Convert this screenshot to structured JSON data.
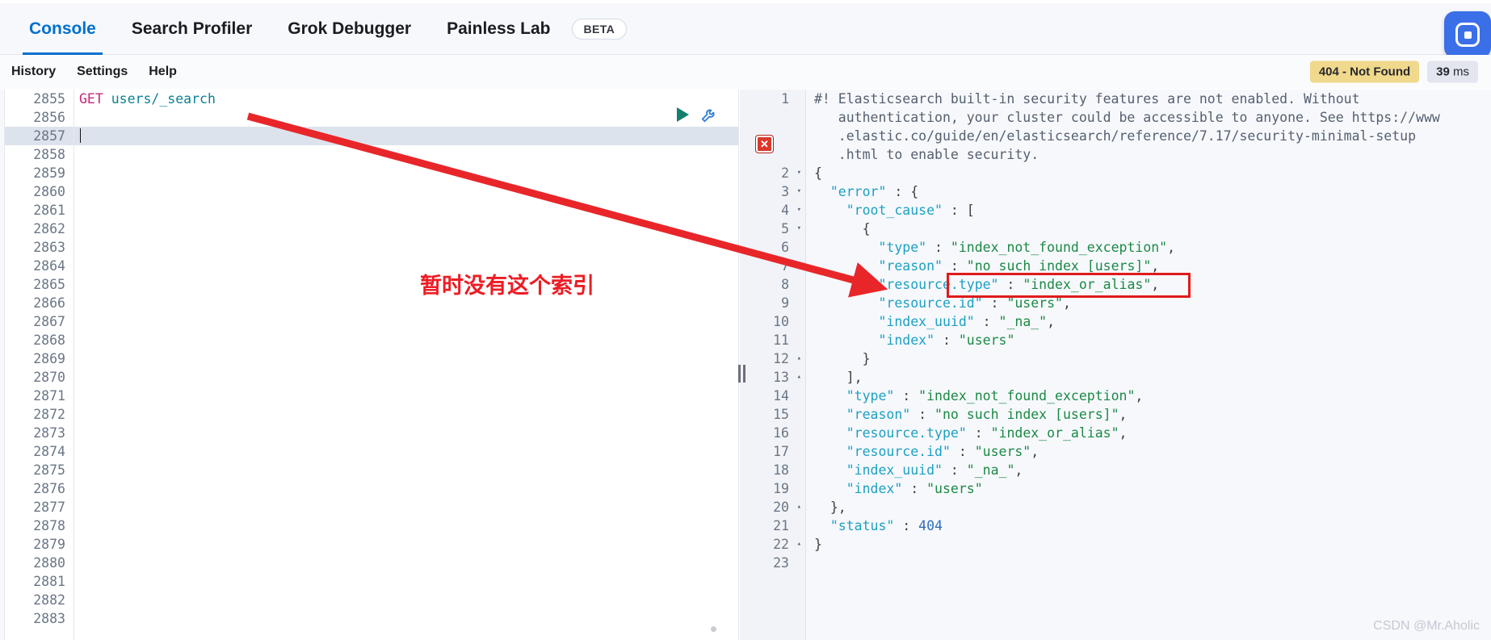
{
  "nav": {
    "tabs": [
      {
        "label": "Console",
        "active": true
      },
      {
        "label": "Search Profiler",
        "active": false
      },
      {
        "label": "Grok Debugger",
        "active": false
      },
      {
        "label": "Painless Lab",
        "active": false
      }
    ],
    "beta_badge": "BETA",
    "corner_icon": "app-logo-icon"
  },
  "subbar": {
    "links": [
      "History",
      "Settings",
      "Help"
    ],
    "status": "404 - Not Found",
    "time_value": "39",
    "time_unit": "ms",
    "status_color": "#f0d98c",
    "time_color": "#e3e6ef"
  },
  "request": {
    "first_line_number": 2855,
    "last_line_number": 2883,
    "highlighted_line": 2857,
    "method": "GET",
    "path": "users/_search",
    "run_icon": "play-icon",
    "tools_icon": "wrench-icon"
  },
  "response": {
    "error_marker_icon": "error-x-icon",
    "lines": [
      {
        "n": 1,
        "fold": "",
        "tokens": [
          {
            "t": "comment",
            "v": "#! Elasticsearch built-in security features are not enabled. Without"
          }
        ]
      },
      {
        "n": "",
        "fold": "",
        "tokens": [
          {
            "t": "comment",
            "v": "   authentication, your cluster could be accessible to anyone. See https://www"
          }
        ]
      },
      {
        "n": "",
        "fold": "",
        "tokens": [
          {
            "t": "comment",
            "v": "   .elastic.co/guide/en/elasticsearch/reference/7.17/security-minimal-setup"
          }
        ]
      },
      {
        "n": "",
        "fold": "",
        "tokens": [
          {
            "t": "comment",
            "v": "   .html to enable security."
          }
        ]
      },
      {
        "n": 2,
        "fold": "▾",
        "tokens": [
          {
            "t": "punct",
            "v": "{"
          }
        ]
      },
      {
        "n": 3,
        "fold": "▾",
        "tokens": [
          {
            "t": "punct",
            "v": "  "
          },
          {
            "t": "key",
            "v": "\"error\""
          },
          {
            "t": "punct",
            "v": " : {"
          }
        ]
      },
      {
        "n": 4,
        "fold": "▾",
        "tokens": [
          {
            "t": "punct",
            "v": "    "
          },
          {
            "t": "key",
            "v": "\"root_cause\""
          },
          {
            "t": "punct",
            "v": " : ["
          }
        ]
      },
      {
        "n": 5,
        "fold": "▾",
        "tokens": [
          {
            "t": "punct",
            "v": "      {"
          }
        ]
      },
      {
        "n": 6,
        "fold": "",
        "tokens": [
          {
            "t": "punct",
            "v": "        "
          },
          {
            "t": "key",
            "v": "\"type\""
          },
          {
            "t": "punct",
            "v": " : "
          },
          {
            "t": "str",
            "v": "\"index_not_found_exception\""
          },
          {
            "t": "punct",
            "v": ","
          }
        ]
      },
      {
        "n": 7,
        "fold": "",
        "tokens": [
          {
            "t": "punct",
            "v": "        "
          },
          {
            "t": "key",
            "v": "\"reason\""
          },
          {
            "t": "punct",
            "v": " : "
          },
          {
            "t": "str",
            "v": "\"no such index [users]\""
          },
          {
            "t": "punct",
            "v": ","
          }
        ]
      },
      {
        "n": 8,
        "fold": "",
        "tokens": [
          {
            "t": "punct",
            "v": "        "
          },
          {
            "t": "key",
            "v": "\"resource.type\""
          },
          {
            "t": "punct",
            "v": " : "
          },
          {
            "t": "str",
            "v": "\"index_or_alias\""
          },
          {
            "t": "punct",
            "v": ","
          }
        ]
      },
      {
        "n": 9,
        "fold": "",
        "tokens": [
          {
            "t": "punct",
            "v": "        "
          },
          {
            "t": "key",
            "v": "\"resource.id\""
          },
          {
            "t": "punct",
            "v": " : "
          },
          {
            "t": "str",
            "v": "\"users\""
          },
          {
            "t": "punct",
            "v": ","
          }
        ]
      },
      {
        "n": 10,
        "fold": "",
        "tokens": [
          {
            "t": "punct",
            "v": "        "
          },
          {
            "t": "key",
            "v": "\"index_uuid\""
          },
          {
            "t": "punct",
            "v": " : "
          },
          {
            "t": "str",
            "v": "\"_na_\""
          },
          {
            "t": "punct",
            "v": ","
          }
        ]
      },
      {
        "n": 11,
        "fold": "",
        "tokens": [
          {
            "t": "punct",
            "v": "        "
          },
          {
            "t": "key",
            "v": "\"index\""
          },
          {
            "t": "punct",
            "v": " : "
          },
          {
            "t": "str",
            "v": "\"users\""
          }
        ]
      },
      {
        "n": 12,
        "fold": "▴",
        "tokens": [
          {
            "t": "punct",
            "v": "      }"
          }
        ]
      },
      {
        "n": 13,
        "fold": "▴",
        "tokens": [
          {
            "t": "punct",
            "v": "    ],"
          }
        ]
      },
      {
        "n": 14,
        "fold": "",
        "tokens": [
          {
            "t": "punct",
            "v": "    "
          },
          {
            "t": "key",
            "v": "\"type\""
          },
          {
            "t": "punct",
            "v": " : "
          },
          {
            "t": "str",
            "v": "\"index_not_found_exception\""
          },
          {
            "t": "punct",
            "v": ","
          }
        ]
      },
      {
        "n": 15,
        "fold": "",
        "tokens": [
          {
            "t": "punct",
            "v": "    "
          },
          {
            "t": "key",
            "v": "\"reason\""
          },
          {
            "t": "punct",
            "v": " : "
          },
          {
            "t": "str",
            "v": "\"no such index [users]\""
          },
          {
            "t": "punct",
            "v": ","
          }
        ]
      },
      {
        "n": 16,
        "fold": "",
        "tokens": [
          {
            "t": "punct",
            "v": "    "
          },
          {
            "t": "key",
            "v": "\"resource.type\""
          },
          {
            "t": "punct",
            "v": " : "
          },
          {
            "t": "str",
            "v": "\"index_or_alias\""
          },
          {
            "t": "punct",
            "v": ","
          }
        ]
      },
      {
        "n": 17,
        "fold": "",
        "tokens": [
          {
            "t": "punct",
            "v": "    "
          },
          {
            "t": "key",
            "v": "\"resource.id\""
          },
          {
            "t": "punct",
            "v": " : "
          },
          {
            "t": "str",
            "v": "\"users\""
          },
          {
            "t": "punct",
            "v": ","
          }
        ]
      },
      {
        "n": 18,
        "fold": "",
        "tokens": [
          {
            "t": "punct",
            "v": "    "
          },
          {
            "t": "key",
            "v": "\"index_uuid\""
          },
          {
            "t": "punct",
            "v": " : "
          },
          {
            "t": "str",
            "v": "\"_na_\""
          },
          {
            "t": "punct",
            "v": ","
          }
        ]
      },
      {
        "n": 19,
        "fold": "",
        "tokens": [
          {
            "t": "punct",
            "v": "    "
          },
          {
            "t": "key",
            "v": "\"index\""
          },
          {
            "t": "punct",
            "v": " : "
          },
          {
            "t": "str",
            "v": "\"users\""
          }
        ]
      },
      {
        "n": 20,
        "fold": "▴",
        "tokens": [
          {
            "t": "punct",
            "v": "  },"
          }
        ]
      },
      {
        "n": 21,
        "fold": "",
        "tokens": [
          {
            "t": "punct",
            "v": "  "
          },
          {
            "t": "key",
            "v": "\"status\""
          },
          {
            "t": "punct",
            "v": " : "
          },
          {
            "t": "num",
            "v": "404"
          }
        ]
      },
      {
        "n": 22,
        "fold": "▴",
        "tokens": [
          {
            "t": "punct",
            "v": "}"
          }
        ]
      },
      {
        "n": 23,
        "fold": "",
        "tokens": [
          {
            "t": "punct",
            "v": ""
          }
        ]
      }
    ]
  },
  "annotations": {
    "note_text": "暂时没有这个索引",
    "note_color": "#ed1c24",
    "arrow_color": "#e8262a",
    "highlight_box_color": "#e01b1b"
  },
  "watermark": "CSDN @Mr.Aholic"
}
